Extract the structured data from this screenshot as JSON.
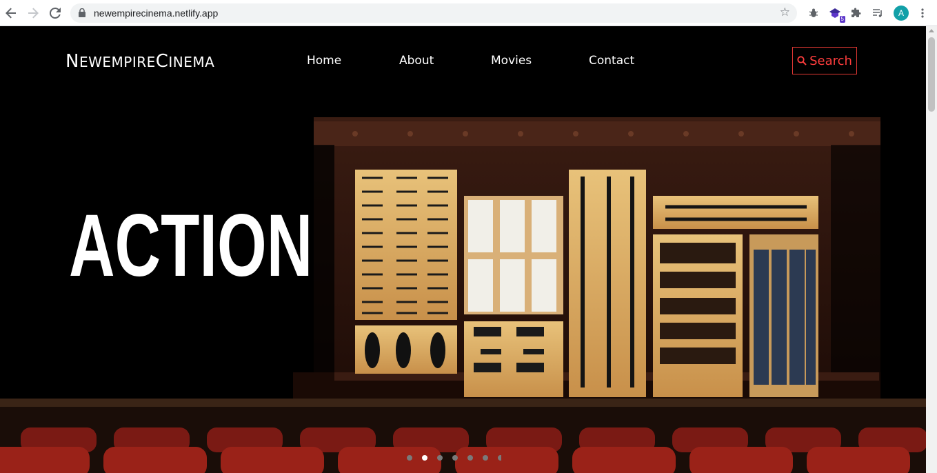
{
  "browser": {
    "url": "newempirecinema.netlify.app",
    "extension_badge": "5",
    "profile_initial": "A"
  },
  "site": {
    "logo": {
      "part1_cap": "N",
      "part1_rest": "EWEMPIRE",
      "part2_cap": "C",
      "part2_rest": "INEMA"
    },
    "nav": {
      "home": "Home",
      "about": "About",
      "movies": "Movies",
      "contact": "Contact"
    },
    "search_label": "Search"
  },
  "hero": {
    "title": "ACTION",
    "slide_count": 7,
    "active_slide": 2
  },
  "colors": {
    "accent": "#e53935",
    "background": "#000000"
  }
}
